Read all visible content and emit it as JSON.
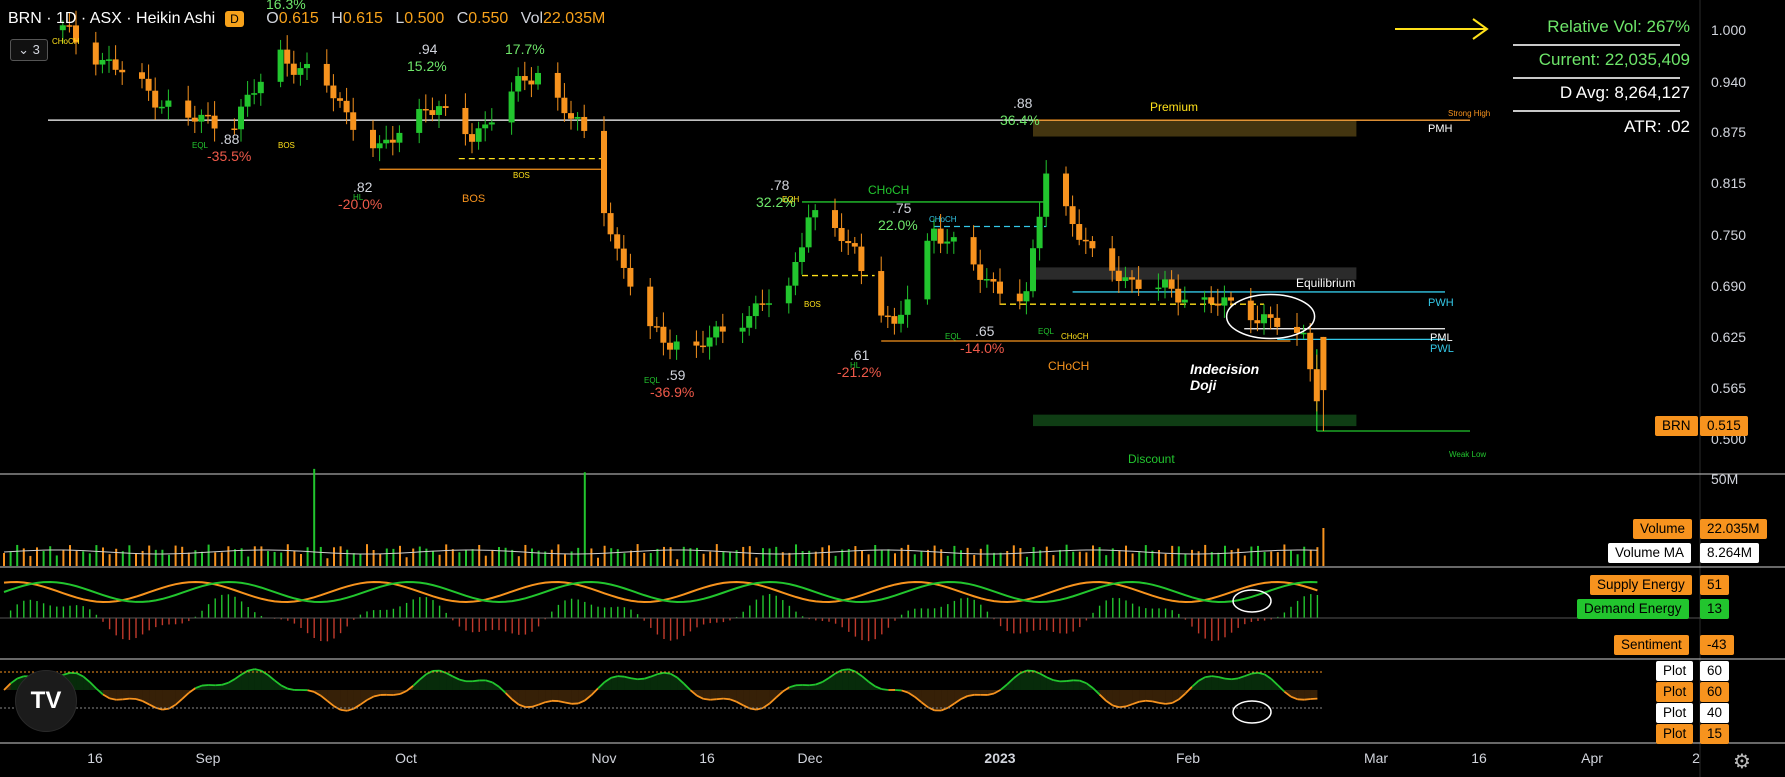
{
  "header": {
    "symbol": "BRN · 1D · ASX · Heikin Ashi",
    "badge": "D",
    "o_label": "O",
    "o": "0.615",
    "h_label": "H",
    "h": "0.615",
    "l_label": "L",
    "l": "0.500",
    "c_label": "C",
    "c": "0.550",
    "vol_label": "Vol",
    "vol": "22.035M",
    "collapse": "⌄ 3"
  },
  "stats": {
    "relative_vol": "Relative Vol: 267%",
    "current": "Current: 22,035,409",
    "d_avg": "D Avg: 8,264,127",
    "atr": "ATR: .02"
  },
  "price_axis": [
    "1.000",
    "0.940",
    "0.875",
    "0.815",
    "0.750",
    "0.690",
    "0.625",
    "0.565",
    "0.500"
  ],
  "volume_axis": "50M",
  "time_axis": [
    "16",
    "Sep",
    "Oct",
    "Nov",
    "16",
    "Dec",
    "2023",
    "Feb",
    "Mar",
    "16",
    "Apr",
    "2"
  ],
  "tags": {
    "brn_name": "BRN",
    "brn_value": "0.515",
    "volume_name": "Volume",
    "volume_value": "22.035M",
    "volma_name": "Volume MA",
    "volma_value": "8.264M",
    "supply_name": "Supply Energy",
    "supply_value": "51",
    "demand_name": "Demand Energy",
    "demand_value": "13",
    "sentiment_name": "Sentiment",
    "sentiment_value": "-43",
    "plot1_name": "Plot",
    "plot1_value": "60",
    "plot2_name": "Plot",
    "plot2_value": "60",
    "plot3_name": "Plot",
    "plot3_value": "40",
    "plot4_name": "Plot",
    "plot4_value": "15"
  },
  "colors": {
    "up": "#22c52e",
    "down": "#f7931e",
    "bg": "#000000",
    "text": "#d1d4dc",
    "cyan": "#33c7e6"
  },
  "annotations": {
    "premium": "Premium",
    "equilibrium": "Equilibrium",
    "discount": "Discount",
    "strong_high": "Strong High",
    "weak_low": "Weak Low",
    "pmh": "PMH",
    "pwh": "PWH",
    "pml": "PML",
    "pwl": "PWL",
    "indecision": "Indecision",
    "doji": "Doji",
    "p88a": ".88",
    "pct_355": "-35.5%",
    "p94": ".94",
    "pct_152": "15.2%",
    "pct_177": "17.7%",
    "p82": ".82",
    "pct_200": "-20.0%",
    "p78": ".78",
    "pct_322": "32.2%",
    "p75": ".75",
    "pct_220": "22.0%",
    "p88b": ".88",
    "pct_364": "36.4%",
    "p65": ".65",
    "pct_140": "-14.0%",
    "p61": ".61",
    "pct_212": "-21.2%",
    "p59": ".59",
    "pct_369": "-36.9%",
    "pct_163": "16.3%",
    "bos": "BOS",
    "choch": "CHoCH",
    "eql": "EQL",
    "eqh": "EQH",
    "hl": "HL"
  },
  "chart_data": {
    "type": "candlestick",
    "title": "BRN · 1D · ASX · Heikin Ashi",
    "ylim": [
      0.48,
      1.03
    ],
    "levels": {
      "pmh": 0.88,
      "pwh": 0.67,
      "pml": 0.625,
      "pwl": 0.612,
      "weak_low": 0.5,
      "bos_oct": 0.82
    },
    "anchors": [
      {
        "date": "2022-08-10",
        "price": 0.99
      },
      {
        "date": "2022-08-22",
        "price": 0.92
      },
      {
        "date": "2022-08-29",
        "price": 0.88
      },
      {
        "date": "2022-09-05",
        "price": 0.88
      },
      {
        "date": "2022-09-12",
        "price": 0.96
      },
      {
        "date": "2022-09-19",
        "price": 0.92
      },
      {
        "date": "2022-09-27",
        "price": 0.84
      },
      {
        "date": "2022-10-04",
        "price": 0.9
      },
      {
        "date": "2022-10-11",
        "price": 0.86
      },
      {
        "date": "2022-10-18",
        "price": 0.92
      },
      {
        "date": "2022-10-21",
        "price": 0.94
      },
      {
        "date": "2022-10-28",
        "price": 0.86
      },
      {
        "date": "2022-11-02",
        "price": 0.72
      },
      {
        "date": "2022-11-07",
        "price": 0.62
      },
      {
        "date": "2022-11-14",
        "price": 0.6
      },
      {
        "date": "2022-11-21",
        "price": 0.64
      },
      {
        "date": "2022-11-28",
        "price": 0.67
      },
      {
        "date": "2022-12-01",
        "price": 0.77
      },
      {
        "date": "2022-12-08",
        "price": 0.72
      },
      {
        "date": "2022-12-14",
        "price": 0.62
      },
      {
        "date": "2022-12-20",
        "price": 0.75
      },
      {
        "date": "2022-12-27",
        "price": 0.69
      },
      {
        "date": "2023-01-03",
        "price": 0.66
      },
      {
        "date": "2023-01-06",
        "price": 0.82
      },
      {
        "date": "2023-01-13",
        "price": 0.71
      },
      {
        "date": "2023-01-20",
        "price": 0.68
      },
      {
        "date": "2023-01-30",
        "price": 0.66
      },
      {
        "date": "2023-02-08",
        "price": 0.64
      },
      {
        "date": "2023-02-14",
        "price": 0.61
      },
      {
        "date": "2023-02-16",
        "price": 0.55
      }
    ],
    "last": {
      "open": 0.615,
      "high": 0.615,
      "low": 0.5,
      "close": 0.55,
      "volume": "22.035M"
    },
    "volume_ma": "8.264M",
    "indicators": {
      "supply_energy": 51,
      "demand_energy": 13,
      "sentiment": -43,
      "plots": [
        60,
        60,
        40,
        15
      ]
    }
  }
}
